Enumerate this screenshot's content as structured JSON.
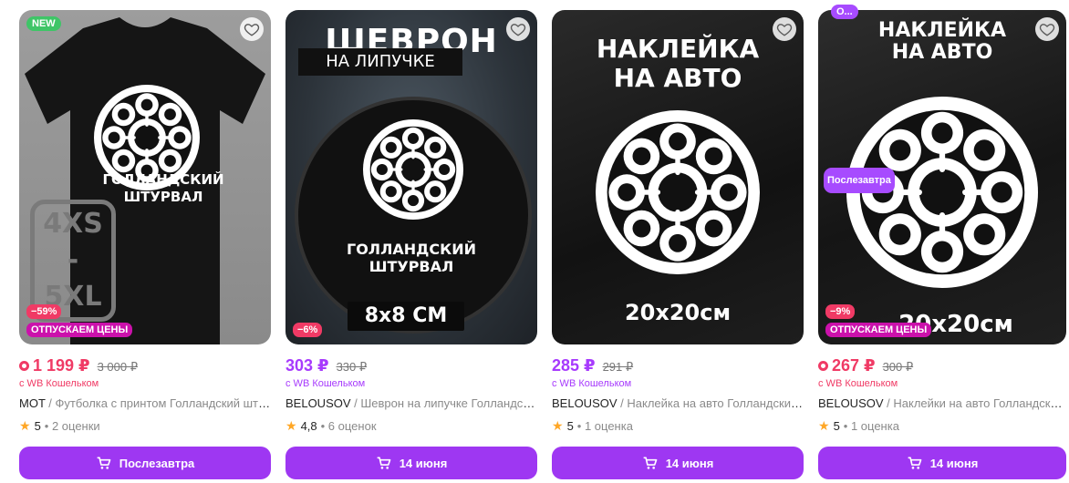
{
  "cards": [
    {
      "badge_new": "NEW",
      "image_text": {
        "line1": "ГОЛЛАНДСКИЙ",
        "line2": "ШТУРВАЛ",
        "sizes": "4XS - 5XL"
      },
      "discount": "−59%",
      "promo": "ОТПУСКАЕМ ЦЕНЫ",
      "price": "1 199 ₽",
      "old_price": "3 000 ₽",
      "wallet": "с WB Кошельком",
      "brand": "MOT",
      "title": " / Футболка с принтом Голландский штурвал",
      "rating": "5",
      "reviews": "• 2 оценки",
      "button": "Послезавтра"
    },
    {
      "image_text": {
        "title1": "ШЕВРОН",
        "title2": "НА ЛИПУЧКЕ",
        "line1": "ГОЛЛАНДСКИЙ",
        "line2": "ШТУРВАЛ",
        "size": "8х8 СМ"
      },
      "discount": "−6%",
      "price": "303 ₽",
      "old_price": "330 ₽",
      "wallet": "с WB Кошельком",
      "brand": "BELOUSOV",
      "title": " / Шеврон на липучке Голландский штурвал",
      "rating": "4,8",
      "reviews": "• 6 оценок",
      "button": "14 июня"
    },
    {
      "image_text": {
        "title1": "НАКЛЕЙКА",
        "title2": "НА АВТО",
        "size": "20х20см"
      },
      "price": "285 ₽",
      "old_price": "291 ₽",
      "wallet": "с WB Кошельком",
      "brand": "BELOUSOV",
      "title": " / Наклейка на авто Голландский штурвал",
      "rating": "5",
      "reviews": "• 1 оценка",
      "button": "14 июня"
    },
    {
      "top_tag": "О...",
      "after_tag": "Послезавтра",
      "image_text": {
        "title1": "НАКЛЕЙКА",
        "title2": "НА АВТО",
        "size": "20х20см"
      },
      "discount": "−9%",
      "promo": "ОТПУСКАЕМ ЦЕНЫ",
      "price": "267 ₽",
      "old_price": "300 ₽",
      "wallet": "с WB Кошельком",
      "brand": "BELOUSOV",
      "title": " / Наклейки на авто Голландский штурвал",
      "rating": "5",
      "reviews": "• 1 оценка",
      "button": "14 июня"
    }
  ],
  "icons": {
    "favorite": "heart-icon",
    "cart": "cart-icon",
    "rating": "star-icon",
    "wallet_price": "wallet-discount-icon"
  },
  "colors": {
    "accent": "#9e37f2",
    "price_violet": "#a73afd",
    "price_red": "#f03a65",
    "promo": "#cb11ab",
    "new_badge": "#3fc567"
  }
}
